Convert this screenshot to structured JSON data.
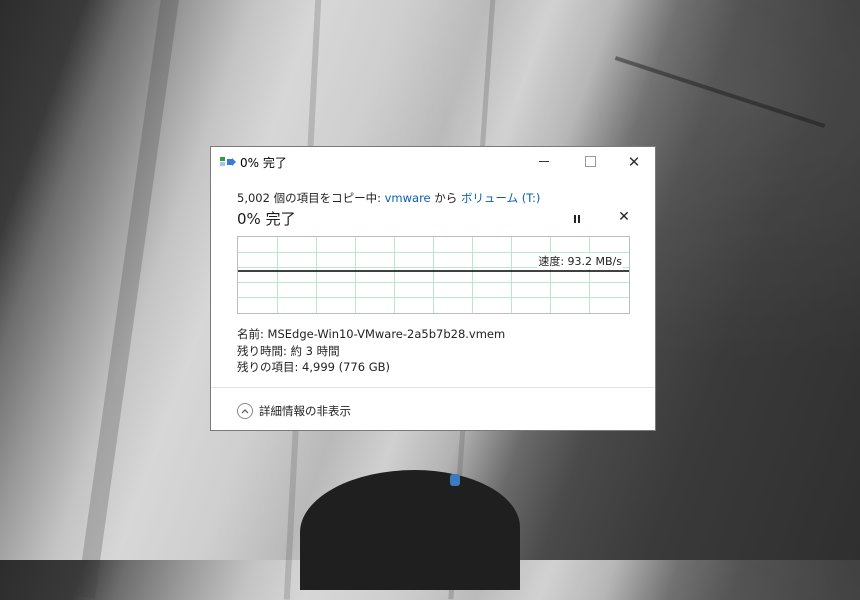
{
  "window": {
    "title": "0% 完了",
    "controls": {
      "minimize": "minimize",
      "maximize": "maximize",
      "close": "✕"
    }
  },
  "copy": {
    "prefix": "5,002 個の項目をコピー中: ",
    "source": "vmware",
    "middle": " から ",
    "destination": "ボリューム (T:)"
  },
  "progress": {
    "title": "0% 完了",
    "percent": 0,
    "cancel_glyph": "✕",
    "speed": "速度: 93.2 MB/s"
  },
  "details": {
    "name": "名前:  MSEdge-Win10-VMware-2a5b7b28.vmem",
    "time_remaining": "残り時間:  約 3 時間",
    "items_remaining": "残りの項目:  4,999 (776 GB)"
  },
  "footer": {
    "toggle_label": "詳細情報の非表示"
  },
  "icons": {
    "app": "file-copy-icon",
    "pause": "pause-icon",
    "cancel": "close-icon",
    "toggle": "chevron-up-icon"
  },
  "colors": {
    "link": "#0a5fb4",
    "grid": "#b8e6cf",
    "speed_line": "#000000",
    "accent_green": "#2ea043",
    "accent_blue": "#3a7bd5"
  }
}
